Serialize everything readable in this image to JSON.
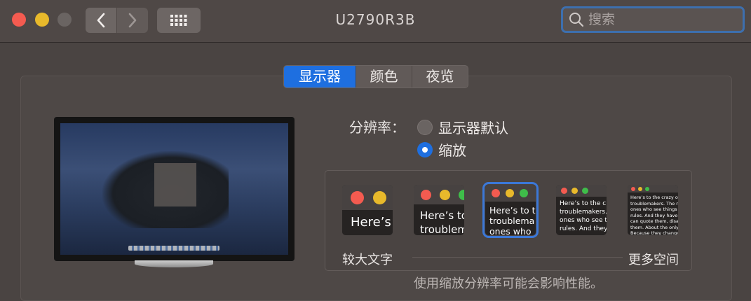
{
  "window": {
    "title": "U2790R3B",
    "search_placeholder": "搜索"
  },
  "tabs": [
    {
      "label": "显示器",
      "selected": true
    },
    {
      "label": "颜色",
      "selected": false
    },
    {
      "label": "夜览",
      "selected": false
    }
  ],
  "resolution": {
    "label": "分辨率：",
    "options": [
      {
        "label": "显示器默认",
        "selected": false
      },
      {
        "label": "缩放",
        "selected": true
      }
    ]
  },
  "scaling": {
    "left_label": "较大文字",
    "right_label": "更多空间",
    "thumbnails": [
      {
        "text": "Here’s",
        "selected": false
      },
      {
        "text": "Here’s to\ntroublem",
        "selected": false
      },
      {
        "text": "Here’s to t\ntroublema\nones who",
        "selected": true
      },
      {
        "text": "Here’s to the cr\ntroublemakers.\nones who see t\nrules. And they",
        "selected": false
      },
      {
        "text": "Here’s to the crazy one\ntroublemakers. The rou\nones who see things dif\nrules. And they have no\ncan quote them, disagre\nthem. About the only th\nBecause they change th",
        "selected": false
      }
    ],
    "note": "使用缩放分辨率可能会影响性能。"
  },
  "colors": {
    "accent": "#1e6fe0",
    "traffic_red": "#f45b50",
    "traffic_yellow": "#e8b92b",
    "traffic_green": "#3fbd4a"
  }
}
